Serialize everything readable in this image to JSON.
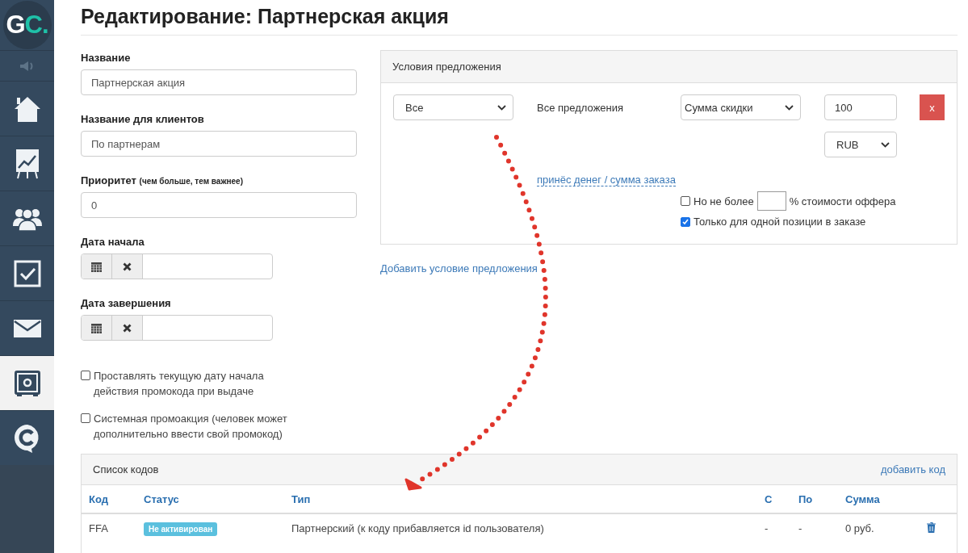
{
  "sidebar": {
    "logo": [
      "G",
      "C."
    ],
    "items": [
      {
        "kind": "speaker",
        "selected": false
      },
      {
        "kind": "home",
        "selected": false
      },
      {
        "kind": "chart",
        "selected": false
      },
      {
        "kind": "people",
        "selected": false
      },
      {
        "kind": "task",
        "selected": false
      },
      {
        "kind": "mail",
        "selected": false
      },
      {
        "kind": "safe",
        "selected": true
      },
      {
        "kind": "chat",
        "selected": false
      }
    ]
  },
  "title": "Редактирование: Партнерская акция",
  "form": {
    "fields": [
      {
        "kind": "text",
        "label": "Название",
        "value": "Партнерская акция"
      },
      {
        "kind": "text",
        "label": "Название для клиентов",
        "value": "По партнерам"
      },
      {
        "kind": "text",
        "label": "Приоритет",
        "hint": "(чем больше, тем важнее)",
        "value": "0"
      },
      {
        "kind": "date",
        "label": "Дата начала"
      },
      {
        "kind": "date",
        "label": "Дата завершения"
      }
    ],
    "checkboxes": [
      {
        "label": "Проставлять текущую дату начала действия промокода при выдаче",
        "checked": false
      },
      {
        "label": "Системная промоакция (человек может дополнительно ввести свой промокод)",
        "checked": false
      }
    ]
  },
  "offer_conditions": {
    "title": "Условия предложения",
    "scope_select": "Все",
    "scope_text": "Все предложения",
    "discount_select": "Сумма скидки",
    "amount": "100",
    "remove_button": "x",
    "currency_select": "RUB",
    "link": "принёс денег / сумма заказа",
    "options": [
      {
        "kind": "limit",
        "label": "Но не более",
        "suffix": "% стоимости оффера",
        "checked": false
      },
      {
        "kind": "plain",
        "label": "Только для одной позиции в заказе",
        "checked": true
      }
    ],
    "add_link": "Добавить условие предложения"
  },
  "codes": {
    "title": "Список кодов",
    "add_link": "добавить код",
    "columns": [
      "Код",
      "Статус",
      "Тип",
      "С",
      "По",
      "Сумма"
    ],
    "rows": [
      {
        "code": "FFA",
        "status": "Не активирован",
        "type": "Партнерский (к коду прибавляется id пользователя)",
        "from": "-",
        "to": "-",
        "sum": "0 руб."
      }
    ]
  }
}
